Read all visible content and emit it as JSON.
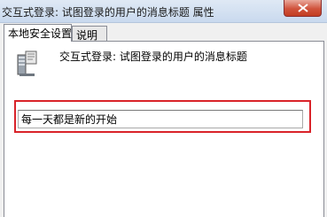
{
  "window": {
    "title": "交互式登录: 试图登录的用户的消息标题 属性"
  },
  "tabs": [
    {
      "label": "本地安全设置",
      "active": true
    },
    {
      "label": "说明",
      "active": false
    }
  ],
  "policy": {
    "name": "交互式登录: 试图登录的用户的消息标题",
    "icon": "server-policy-icon"
  },
  "message_title_field": {
    "value": "每一天都是新的开始"
  },
  "colors": {
    "highlight_border": "#d9232a",
    "close_button": "#c9452b"
  }
}
